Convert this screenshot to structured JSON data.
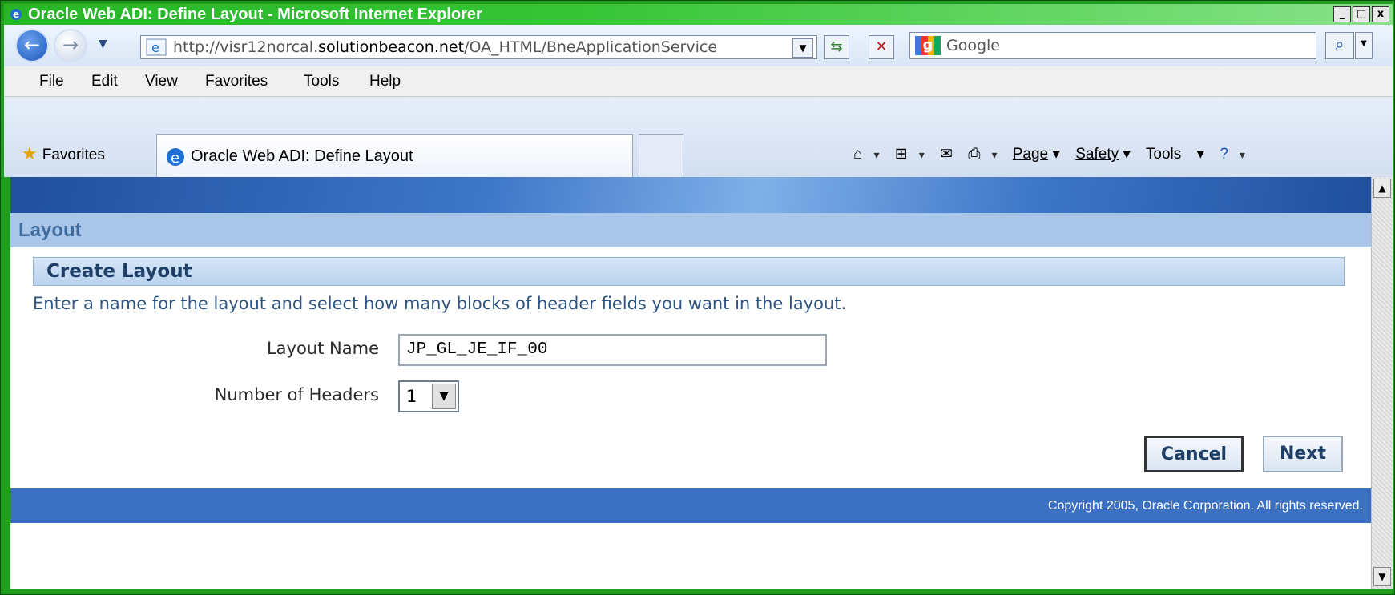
{
  "window": {
    "title": "Oracle Web ADI: Define Layout - Microsoft Internet Explorer",
    "controls": [
      "_",
      "□",
      "x"
    ]
  },
  "address": {
    "url_prefix": "http://visr12norcal.",
    "url_domain": "solutionbeacon.net",
    "url_suffix": "/OA_HTML/BneApplicationService"
  },
  "search": {
    "placeholder": "Google"
  },
  "menu": {
    "items": [
      "File",
      "Edit",
      "View",
      "Favorites",
      "Tools",
      "Help"
    ]
  },
  "favorites_bar": {
    "favorites_label": "Favorites",
    "active_tab_label": "Oracle Web ADI: Define Layout",
    "page_label": "Page",
    "safety_label": "Safety",
    "tools_label": "Tools"
  },
  "page": {
    "section_title": "Layout",
    "subsection_title": "Create Layout",
    "instruction": "Enter a name for the layout and select how many blocks of header fields you want in the layout.",
    "layout_name_label": "Layout Name",
    "layout_name_value": "JP_GL_JE_IF_00",
    "num_headers_label": "Number of Headers",
    "num_headers_value": "1",
    "cancel_label": "Cancel",
    "next_label": "Next",
    "copyright": "Copyright 2005, Oracle Corporation. All rights reserved."
  },
  "colors": {
    "title_bar": "#27b627",
    "layout_header_bg": "#a9c6e8",
    "footer_bg": "#3b70c2",
    "label_text": "#2e5582"
  }
}
